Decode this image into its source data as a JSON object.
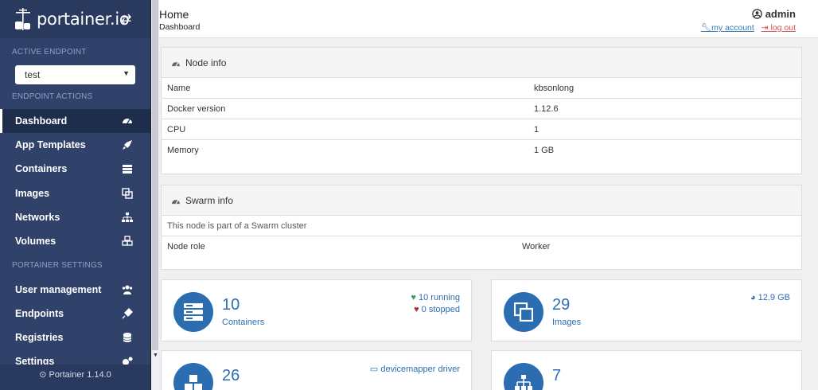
{
  "sidebar": {
    "brand": "portainer.io",
    "active_endpoint_label": "ACTIVE ENDPOINT",
    "endpoint_selected": "test",
    "endpoint_actions_label": "ENDPOINT ACTIONS",
    "portainer_settings_label": "PORTAINER SETTINGS",
    "nav": [
      {
        "label": "Dashboard",
        "icon": "tachometer-icon"
      },
      {
        "label": "App Templates",
        "icon": "rocket-icon"
      },
      {
        "label": "Containers",
        "icon": "server-icon"
      },
      {
        "label": "Images",
        "icon": "clone-icon"
      },
      {
        "label": "Networks",
        "icon": "sitemap-icon"
      },
      {
        "label": "Volumes",
        "icon": "cubes-icon"
      }
    ],
    "settings_nav": [
      {
        "label": "User management",
        "icon": "users-icon"
      },
      {
        "label": "Endpoints",
        "icon": "plug-icon"
      },
      {
        "label": "Registries",
        "icon": "database-icon"
      },
      {
        "label": "Settings",
        "icon": "cogs-icon"
      }
    ],
    "footer": "Portainer 1.14.0"
  },
  "header": {
    "title": "Home",
    "breadcrumb": "Dashboard",
    "user": "admin",
    "my_account": "my account",
    "log_out": "log out"
  },
  "node_info": {
    "title": "Node info",
    "rows": [
      {
        "key": "Name",
        "value": "kbsonlong"
      },
      {
        "key": "Docker version",
        "value": "1.12.6"
      },
      {
        "key": "CPU",
        "value": "1"
      },
      {
        "key": "Memory",
        "value": "1 GB"
      }
    ]
  },
  "swarm_info": {
    "title": "Swarm info",
    "note": "This node is part of a Swarm cluster",
    "role_key": "Node role",
    "role_value": "Worker"
  },
  "tiles": {
    "containers": {
      "count": "10",
      "label": "Containers",
      "running": "10 running",
      "stopped": "0 stopped"
    },
    "images": {
      "count": "29",
      "label": "Images",
      "size": "12.9 GB"
    },
    "volumes": {
      "count": "26",
      "driver": "devicemapper driver"
    },
    "networks": {
      "count": "7"
    }
  },
  "colors": {
    "sidebar": "#30426a",
    "accent": "#2c6db1",
    "running": "#3c9b5f",
    "stopped": "#b02a37"
  }
}
